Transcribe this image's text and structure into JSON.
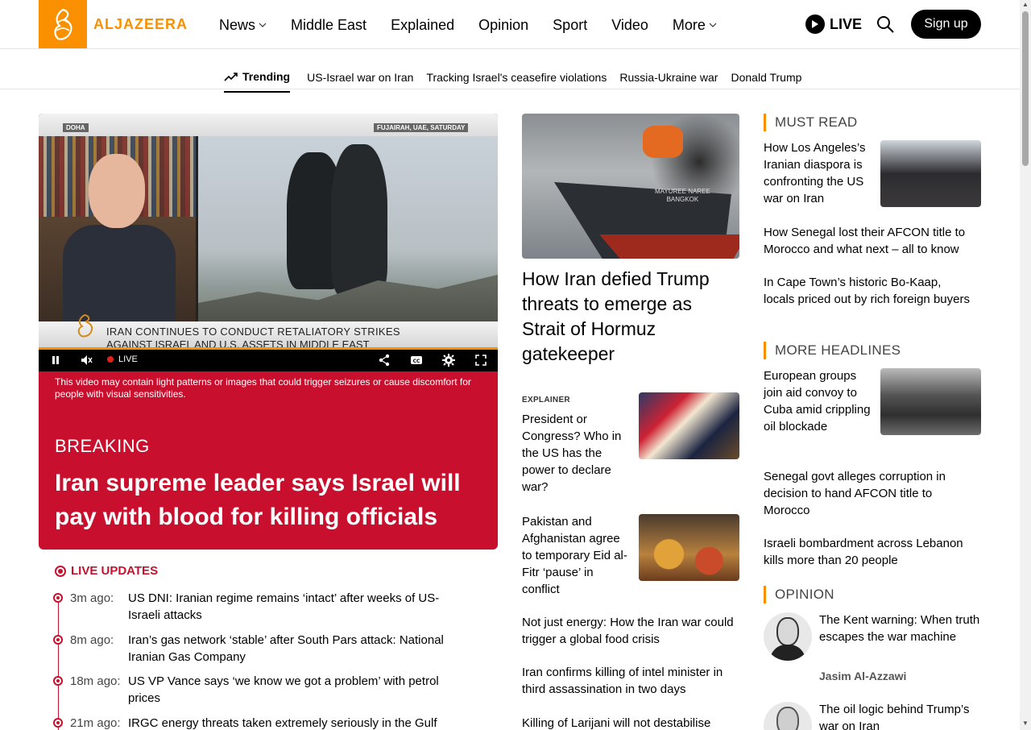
{
  "brand": {
    "name": "ALJAZEERA",
    "accent": "#fa9000",
    "breaking_color": "#c8102e"
  },
  "nav": {
    "items": [
      {
        "label": "News",
        "dropdown": true
      },
      {
        "label": "Middle East",
        "dropdown": false
      },
      {
        "label": "Explained",
        "dropdown": false
      },
      {
        "label": "Opinion",
        "dropdown": false
      },
      {
        "label": "Sport",
        "dropdown": false
      },
      {
        "label": "Video",
        "dropdown": false
      },
      {
        "label": "More",
        "dropdown": true
      }
    ],
    "live_label": "LIVE",
    "signup_label": "Sign up"
  },
  "trending": {
    "label": "Trending",
    "links": [
      "US-Israel war on Iran",
      "Tracking Israel's ceasefire violations",
      "Russia-Ukraine war",
      "Donald Trump"
    ]
  },
  "video": {
    "tag_left": "DOHA",
    "tag_right": "FUJAIRAH, UAE, SATURDAY",
    "lower_third_line1": "IRAN CONTINUES TO CONDUCT RETALIATORY STRIKES",
    "lower_third_line2": "AGAINST ISRAEL AND U.S. ASSETS IN MIDDLE EAST",
    "live_label": "LIVE",
    "warning": "This video may contain light patterns or images that could trigger seizures or cause discomfort for people with visual sensitivities."
  },
  "breaking": {
    "label": "BREAKING",
    "title": "Iran supreme leader says Israel will pay with blood for killing officials"
  },
  "live_updates": {
    "label": "LIVE UPDATES",
    "items": [
      {
        "time": "3m ago:",
        "text": "US DNI: Iranian regime remains ‘intact’ after weeks of US-Israeli attacks"
      },
      {
        "time": "8m ago:",
        "text": "Iran’s gas network ‘stable’ after South Pars attack: National Iranian Gas Company"
      },
      {
        "time": "18m ago:",
        "text": "US VP Vance says ‘we know we got a problem’ with petrol prices"
      },
      {
        "time": "21m ago:",
        "text": "IRGC energy threats taken extremely seriously in the Gulf"
      }
    ]
  },
  "middle": {
    "ship_caption_line1": "MAYUREE NAREE",
    "ship_caption_line2": "BANGKOK",
    "main_title": "How Iran defied Trump threats to emerge as Strait of Hormuz gatekeeper",
    "story1": {
      "kicker": "EXPLAINER",
      "title": "President or Congress? Who in the US has the power to declare war?"
    },
    "story2": {
      "title": "Pakistan and Afghanistan agree to temporary Eid al-Fitr ‘pause’ in conflict"
    },
    "story3": {
      "title": "Not just energy: How the Iran war could trigger a global food crisis"
    },
    "story4": {
      "title": "Iran confirms killing of intel minister in third assassination in two days"
    },
    "story5": {
      "title": "Killing of Larijani will not destabilise"
    }
  },
  "right": {
    "must_read": {
      "label": "MUST READ",
      "items": [
        "How Los Angeles’s Iranian diaspora is confronting the US war on Iran",
        "How Senegal lost their AFCON title to Morocco and what next – all to know",
        "In Cape Town’s historic Bo-Kaap, locals priced out by rich foreign buyers"
      ]
    },
    "more_headlines": {
      "label": "MORE HEADLINES",
      "items": [
        "European groups join aid convoy to Cuba amid crippling oil blockade",
        "Senegal govt alleges corruption in decision to hand AFCON title to Morocco",
        "Israeli bombardment across Lebanon kills more than 20 people"
      ]
    },
    "opinion": {
      "label": "OPINION",
      "items": [
        {
          "title": "The Kent warning: When truth escapes the war machine",
          "author": "Jasim Al-Azzawi"
        },
        {
          "title": "The oil logic behind Trump’s war on Iran",
          "author": ""
        }
      ]
    }
  }
}
